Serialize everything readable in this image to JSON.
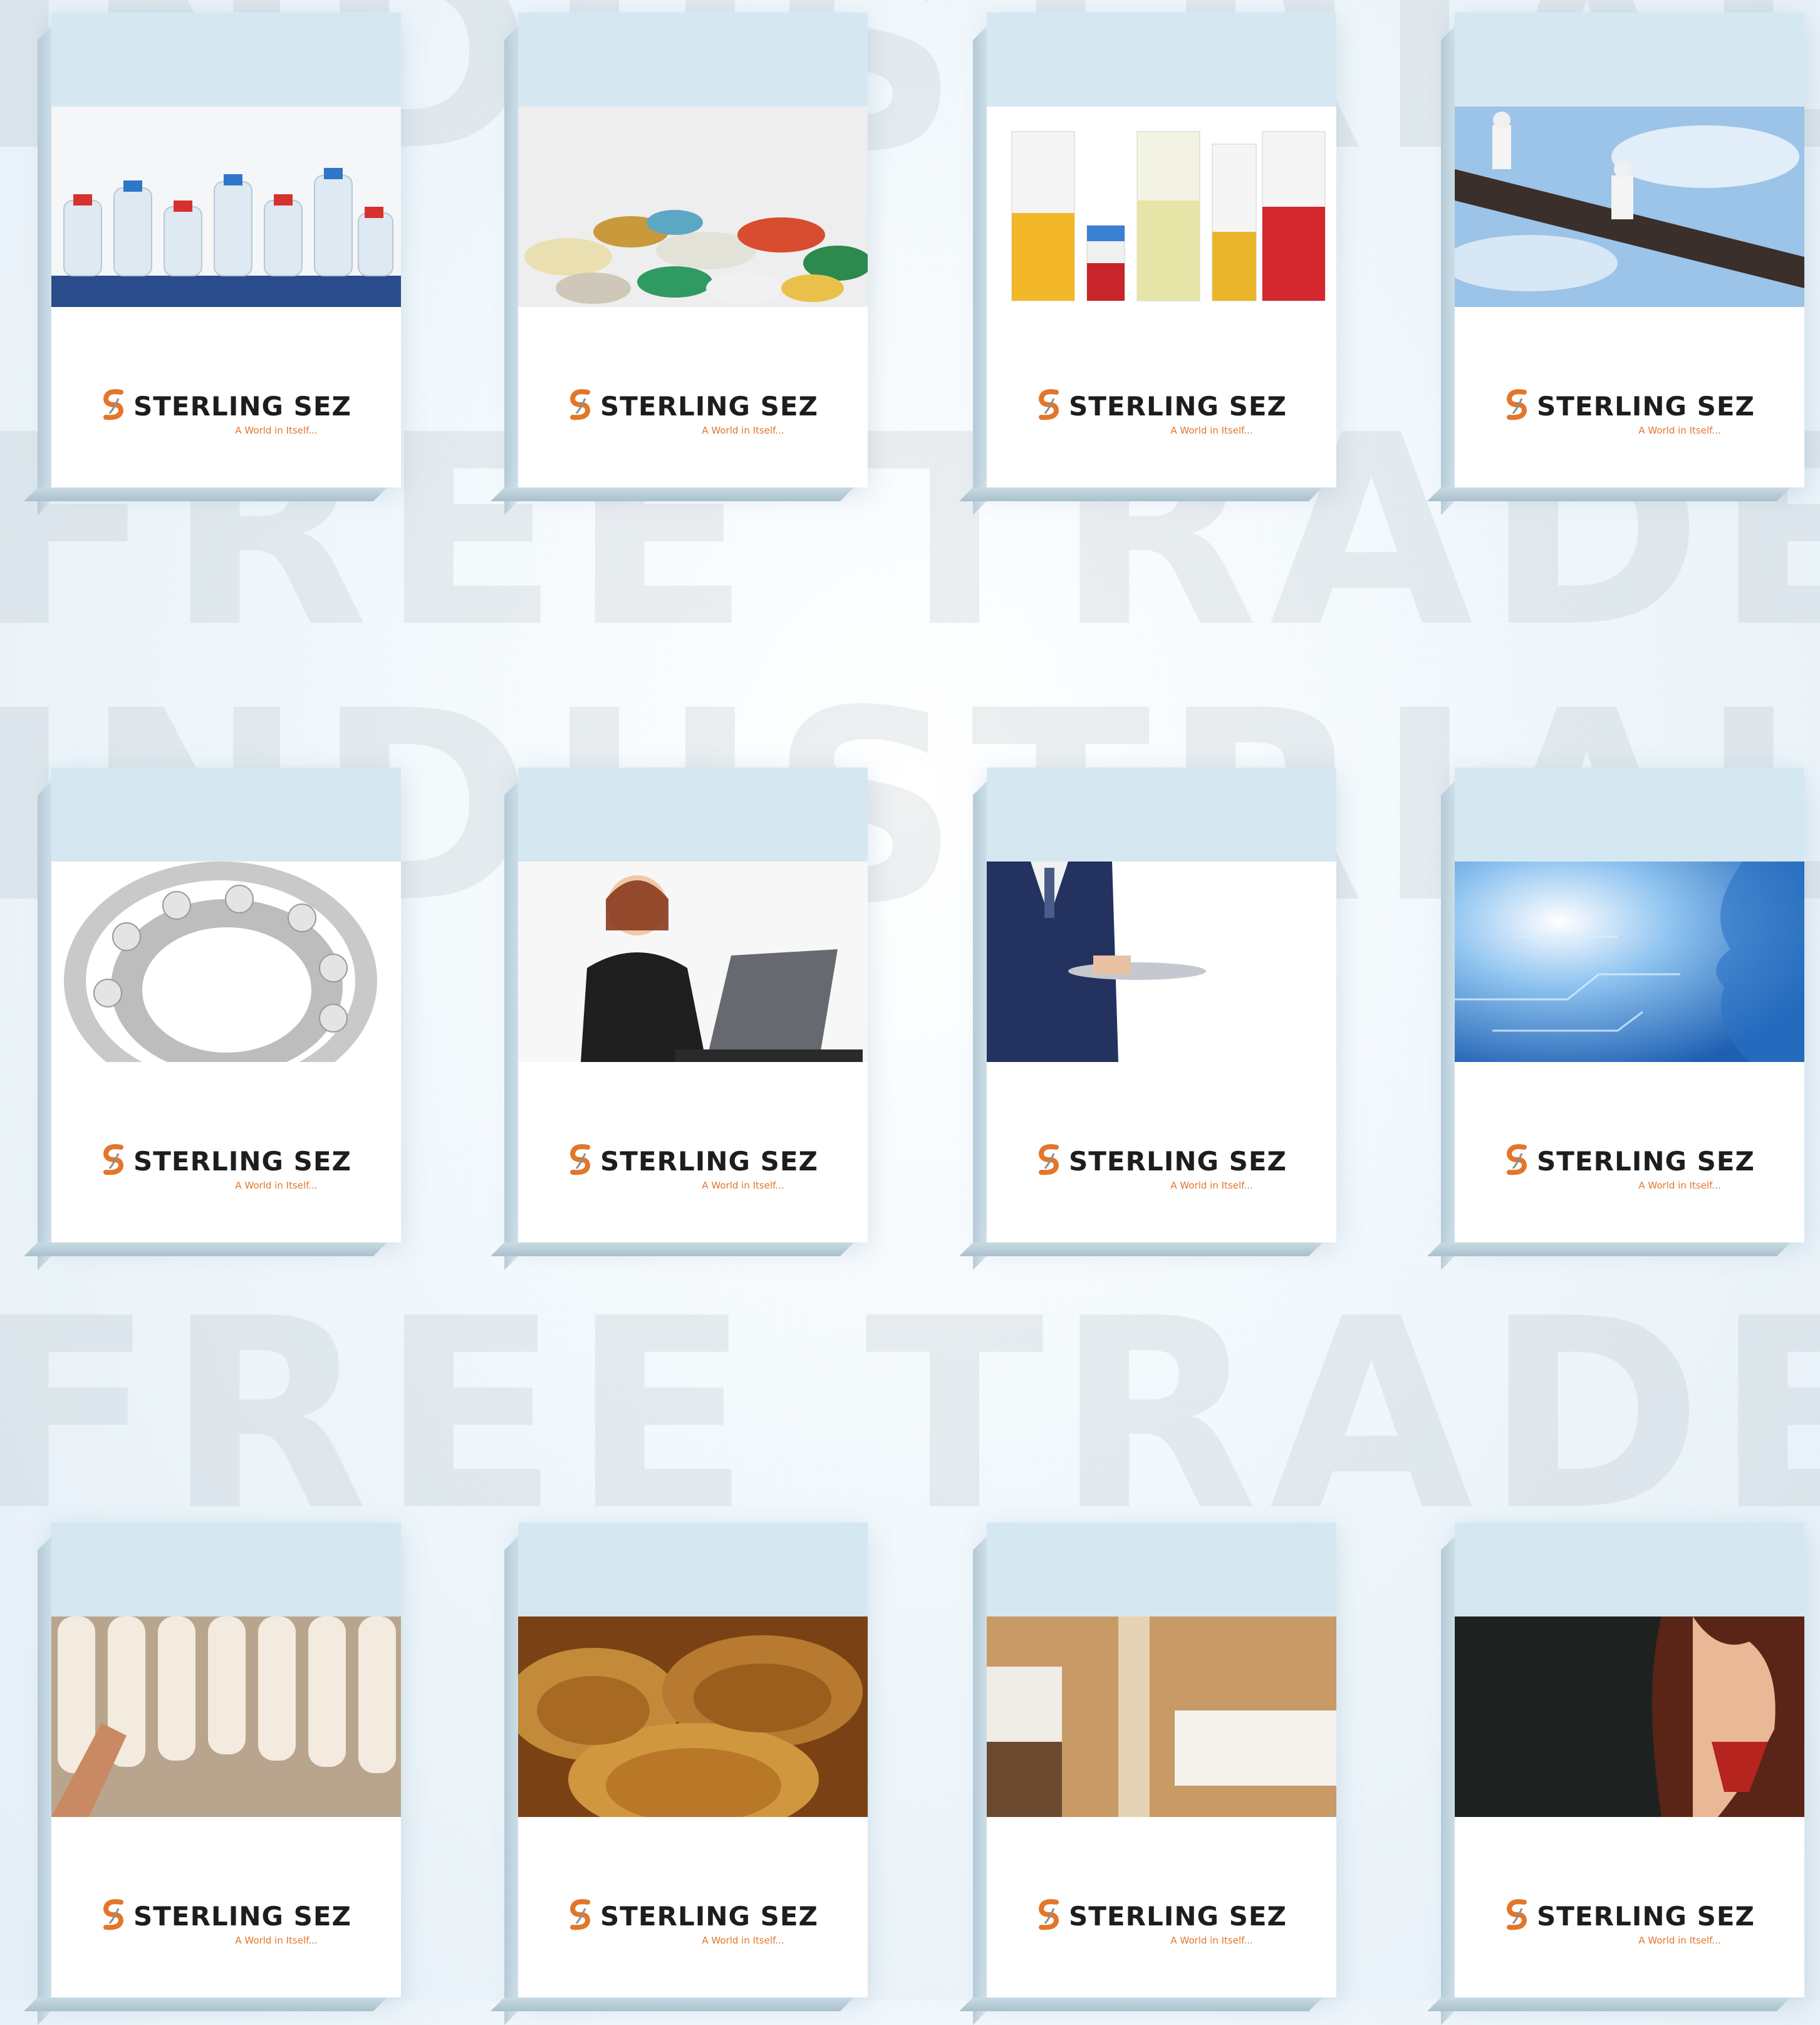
{
  "background_words": [
    "INDUSTRIAL ZONE",
    "FREE TRADE ZONE",
    "INDUSTRIAL ZONE",
    "FREE TRADE ZONE"
  ],
  "brand": {
    "name": "STERLING SEZ",
    "tagline": "A World in Itself...",
    "accent_color": "#e3762a"
  },
  "books": [
    {
      "name": "plastic-bottles",
      "photo": "bottles"
    },
    {
      "name": "pills",
      "photo": "pills"
    },
    {
      "name": "lab-beakers",
      "photo": "beakers"
    },
    {
      "name": "construction-workers",
      "photo": "construction"
    },
    {
      "name": "ball-bearing",
      "photo": "bearing"
    },
    {
      "name": "call-center-agent",
      "photo": "callcenter"
    },
    {
      "name": "waiter-tray",
      "photo": "waiter"
    },
    {
      "name": "digital-face",
      "photo": "digital"
    },
    {
      "name": "textile-spindles",
      "photo": "textile"
    },
    {
      "name": "grain-sacks",
      "photo": "grain"
    },
    {
      "name": "bathroom-tiles",
      "photo": "bathroom"
    },
    {
      "name": "fashion-woman",
      "photo": "fashion"
    }
  ]
}
